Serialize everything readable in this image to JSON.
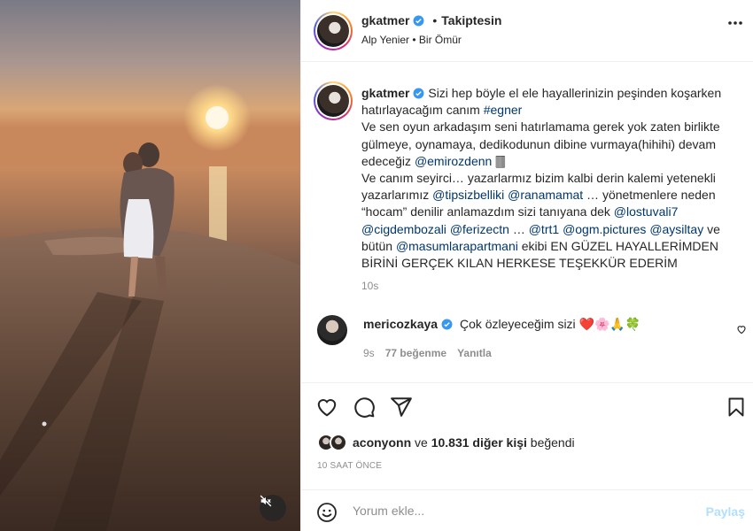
{
  "post": {
    "author": "gkatmer",
    "follow_separator": "•",
    "follow_status": "Takiptesin",
    "audio": "Alp Yenier • Bir Ömür"
  },
  "caption": {
    "username": "gkatmer",
    "p1": "Sizi hep böyle el ele hayallerinizin peşinden koşarken hatırlayacağım canım ",
    "tag_egner": "#egner",
    "p2": "Ve sen oyun arkadaşım seni hatırlamama gerek yok zaten birlikte gülmeye, oynamaya, dedikodunun dibine vurmaya(hihihi) devam edeceğiz ",
    "m_emirozdenn": "@emirozdenn",
    "p2_end": " 🀫",
    "p3": "Ve canım seyirci… yazarlarmız bizim kalbi derin kalemi yetenekli yazarlarımız ",
    "m_tipsizbelliki": "@tipsizbelliki",
    "m_ranamamat": "@ranamamat",
    "p3b": " … yönetmenlere neden “hocam” denilir anlamazdım sizi tanıyana dek ",
    "m_lostuvali7": "@lostuvali7",
    "m_cigdembozali": "@cigdembozali",
    "m_ferizectn": "@ferizectn",
    "p3c": " … ",
    "m_trt1": "@trt1",
    "m_ogmpictures": "@ogm.pictures",
    "m_aysiltay": "@aysiltay",
    "p3d": " ve bütün ",
    "m_masumlarapartmani": "@masumlarapartmani",
    "p3e": " ekibi EN GÜZEL HAYALLERİMDEN BİRİNİ GERÇEK KILAN HERKESE TEŞEKKÜR EDERİM",
    "time": "10s"
  },
  "comment": {
    "username": "mericozkaya",
    "text": "Çok özleyeceğim sizi ❤️🌸🙏🍀",
    "time": "9s",
    "likes": "77 beğenme",
    "reply": "Yanıtla"
  },
  "likes": {
    "user": "aconyonn",
    "middle": " ve ",
    "count": "10.831 diğer kişi",
    "end": " beğendi"
  },
  "time_ago": "10 SAAT ÖNCE",
  "input": {
    "placeholder": "Yorum ekle...",
    "share_label": "Paylaş"
  },
  "colors": {
    "link": "#00376b",
    "verified": "#3897f0",
    "muted": "#8e8e8e",
    "share_disabled": "#b2dffc",
    "heart_red": "#ed4956"
  },
  "icons": [
    "verified-badge-icon",
    "more-options-icon",
    "heart-icon",
    "comment-icon",
    "share-icon",
    "bookmark-icon",
    "emoji-icon",
    "mute-icon"
  ]
}
